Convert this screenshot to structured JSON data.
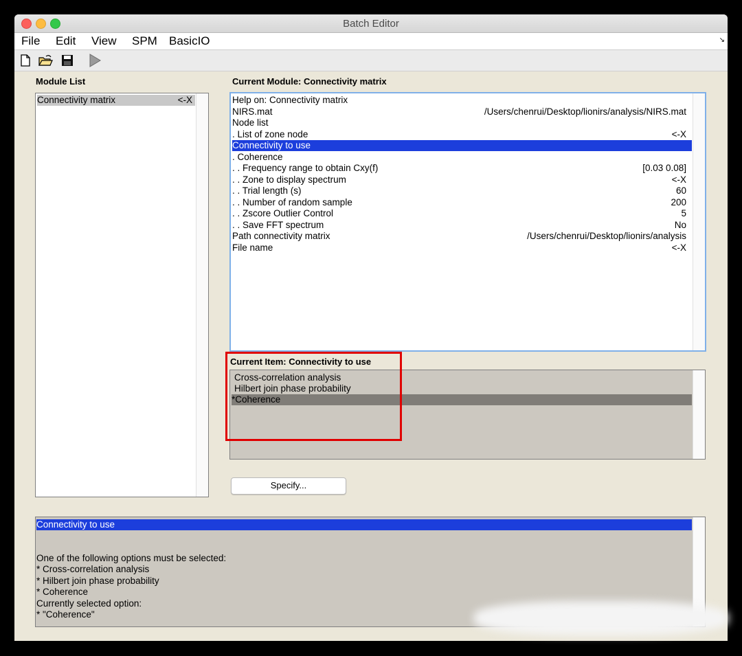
{
  "window": {
    "title": "Batch Editor"
  },
  "menu": {
    "items": [
      "File",
      "Edit",
      "View",
      "SPM",
      "BasicIO"
    ]
  },
  "toolbar": {
    "icons": [
      "new-file-icon",
      "open-folder-icon",
      "save-icon",
      "run-icon"
    ]
  },
  "module_list": {
    "title": "Module List",
    "items": [
      {
        "label": "Connectivity matrix",
        "value": "<-X"
      }
    ]
  },
  "current_module": {
    "title": "Current Module: Connectivity matrix",
    "rows": [
      {
        "label": "Help on: Connectivity matrix",
        "value": ""
      },
      {
        "label": "NIRS.mat",
        "value": "/Users/chenrui/Desktop/lionirs/analysis/NIRS.mat"
      },
      {
        "label": "Node list",
        "value": ""
      },
      {
        "label": ". List of zone node",
        "value": "<-X"
      },
      {
        "label": "Connectivity to use",
        "value": ""
      },
      {
        "label": ". Coherence",
        "value": ""
      },
      {
        "label": ". . Frequency range to obtain Cxy(f)",
        "value": "[0.03 0.08]"
      },
      {
        "label": ". . Zone to display spectrum",
        "value": "<-X"
      },
      {
        "label": ". . Trial length (s)",
        "value": "60"
      },
      {
        "label": ". . Number of random sample",
        "value": "200"
      },
      {
        "label": ". . Zscore Outlier Control",
        "value": "5"
      },
      {
        "label": ". . Save FFT spectrum",
        "value": "No"
      },
      {
        "label": "Path connectivity matrix",
        "value": "/Users/chenrui/Desktop/lionirs/analysis"
      },
      {
        "label": "File name",
        "value": "<-X"
      }
    ]
  },
  "current_item": {
    "title": "Current Item: Connectivity to use",
    "options": [
      "Cross-correlation analysis",
      "Hilbert join phase probability",
      "*Coherence"
    ]
  },
  "specify_button": {
    "label": "Specify..."
  },
  "help_panel": {
    "lines": [
      "Connectivity to use",
      "",
      "",
      "One of the following options must be selected:",
      "* Cross-correlation analysis",
      "* Hilbert join phase probability",
      "* Coherence",
      "Currently selected option:",
      "* \"Coherence\""
    ]
  },
  "colors": {
    "selection": "#1c3edc",
    "selection_grey": "#807d78",
    "window_bg": "#ebe7d9",
    "highlight": "#e00000"
  }
}
